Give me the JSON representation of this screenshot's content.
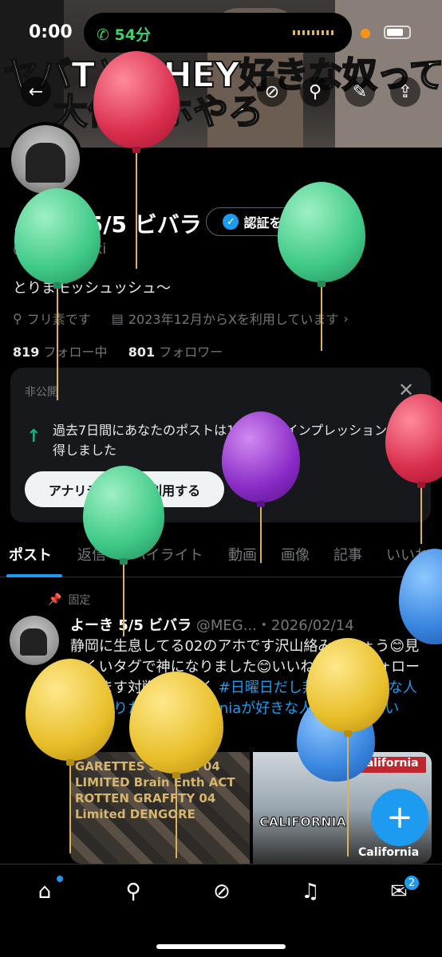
{
  "status_bar": {
    "time": "0:00",
    "call_duration": "54分"
  },
  "banner": {
    "line1": "ヤバTとかHEY好きな奴って",
    "line2": "大体アホやろ"
  },
  "profile": {
    "name": "よーき 5/5 ビバラ",
    "verify_label": "認証を受ける",
    "handle": "@MEGA_yoki",
    "bio": "とりまモッシュッシュ〜",
    "location": "フリ素です",
    "joined": "2023年12月からXを利用しています",
    "following_count": "819",
    "following_label": "フォロー中",
    "followers_count": "801",
    "followers_label": "フォロワー"
  },
  "analytics_card": {
    "label": "非公開",
    "text": "過去7日間にあなたのポストは1.2万件のインプレッションを獲得しました",
    "button": "アナリティクスを利用する"
  },
  "tabs": [
    "ポスト",
    "返信",
    "ハイライト",
    "動画",
    "画像",
    "記事",
    "いいね"
  ],
  "post": {
    "pinned_label": "固定",
    "author": "よーき 5/5 ビバラ",
    "handle_date": "@MEG...・2026/02/14",
    "text": "静岡に生息してる02のアホです沢山絡みましょう😊見にくいタグで神になりました😊いいねorRPでフォローいきます対戦よろしく",
    "tags": "#日曜日だし邦ロック好きな人と繋がりたい #Californiaが好きな人と繋がりたい",
    "media1_text": "GARETTES SiM SiZ 04 LIMITED Brain Enth ACT ROTTEN GRAFFTY 04 Limited DENGORE",
    "media2_banner": "California",
    "media2_text": "CALIFORNIA",
    "media2_text2": "California"
  },
  "nav": {
    "messages_badge": "2"
  },
  "colors": {
    "accent": "#1d9bf0",
    "background": "#000000",
    "card": "#16181c"
  }
}
